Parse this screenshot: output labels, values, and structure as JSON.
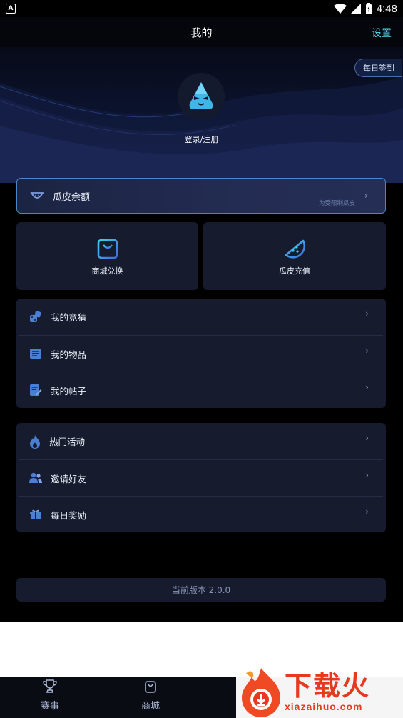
{
  "status_bar": {
    "time": "4:48",
    "notification_glyph": "A"
  },
  "header": {
    "title": "我的",
    "settings_label": "设置"
  },
  "hero": {
    "checkin_label": "每日签到",
    "login_label": "登录/注册"
  },
  "balance": {
    "label": "瓜皮余额",
    "sub_label": "为受限制瓜皮"
  },
  "tiles": [
    {
      "label": "商城兑换",
      "icon": "shopping-bag-icon"
    },
    {
      "label": "瓜皮充值",
      "icon": "watermelon-icon"
    }
  ],
  "menu_group_1": [
    {
      "label": "我的竞猜",
      "icon": "dice-icon"
    },
    {
      "label": "我的物品",
      "icon": "list-icon"
    },
    {
      "label": "我的帖子",
      "icon": "edit-note-icon"
    }
  ],
  "menu_group_2": [
    {
      "label": "热门活动",
      "icon": "fire-icon"
    },
    {
      "label": "邀请好友",
      "icon": "people-icon"
    },
    {
      "label": "每日奖励",
      "icon": "gift-icon"
    }
  ],
  "version": "当前版本 2.0.0",
  "tabbar": [
    {
      "label": "赛事",
      "icon": "trophy-icon"
    },
    {
      "label": "商城",
      "icon": "shopping-bag-icon"
    }
  ],
  "watermark": {
    "brand": "下载火",
    "domain": "xiazaihuo.com"
  },
  "colors": {
    "accent": "#4fd2e6",
    "card": "#161b2d",
    "icon_blue": "#4a7fd4",
    "watermark": "#e8391f"
  }
}
